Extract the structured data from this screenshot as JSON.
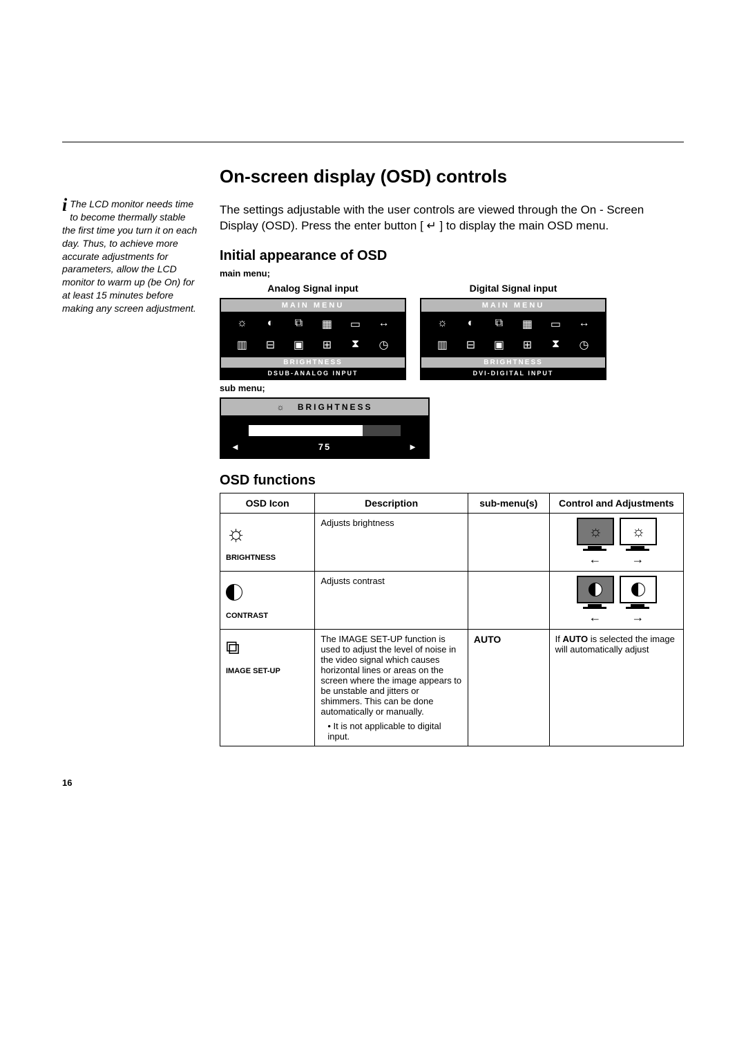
{
  "headings": {
    "h1": "On-screen display (OSD) controls",
    "h2a": "Initial appearance of OSD",
    "h2b": "OSD functions"
  },
  "sidebar_note": "The LCD monitor needs time to become thermally stable the first time you turn it on each day. Thus, to achieve more accurate adjustments for parameters, allow the LCD monitor to warm up (be On) for at least 15 minutes before making any screen adjustment.",
  "intro": "The settings adjustable with the user controls are viewed through the On - Screen Display (OSD). Press the enter button [ ↵ ] to display the main OSD menu.",
  "labels": {
    "main_menu": "main menu;",
    "sub_menu": "sub menu;",
    "analog": "Analog Signal input",
    "digital": "Digital Signal input"
  },
  "osd": {
    "main_title": "MAIN MENU",
    "subtitle": "BRIGHTNESS",
    "input_analog": "DSUB-ANALOG INPUT",
    "input_digital": "DVI-DIGITAL INPUT",
    "sub_title": "BRIGHTNESS",
    "sub_value": "75",
    "left_arrow": "◄",
    "right_arrow": "►"
  },
  "table": {
    "headers": [
      "OSD Icon",
      "Description",
      "sub-menu(s)",
      "Control and Adjustments"
    ],
    "rows": [
      {
        "icon_label": "BRIGHTNESS",
        "icon_glyph": "☼",
        "description": "Adjusts brightness",
        "submenu": "",
        "adjust_type": "monitors",
        "mon_glyph": "☼"
      },
      {
        "icon_label": "CONTRAST",
        "icon_glyph": "half",
        "description": "Adjusts contrast",
        "submenu": "",
        "adjust_type": "monitors",
        "mon_glyph": "half"
      },
      {
        "icon_label": "IMAGE SET-UP",
        "icon_glyph": "⧉",
        "description": "The IMAGE SET-UP function is used to adjust the level of noise in the video signal which causes horizontal lines or areas on the screen where the image appears to be unstable and jitters or shimmers. This can be done automatically or manually.",
        "description_bullet": "• It is not applicable to digital input.",
        "submenu": "AUTO",
        "adjust_type": "text",
        "adjust_text": "If AUTO is selected the image will automatically adjust",
        "adjust_bold": "AUTO"
      }
    ]
  },
  "page_number": "16"
}
